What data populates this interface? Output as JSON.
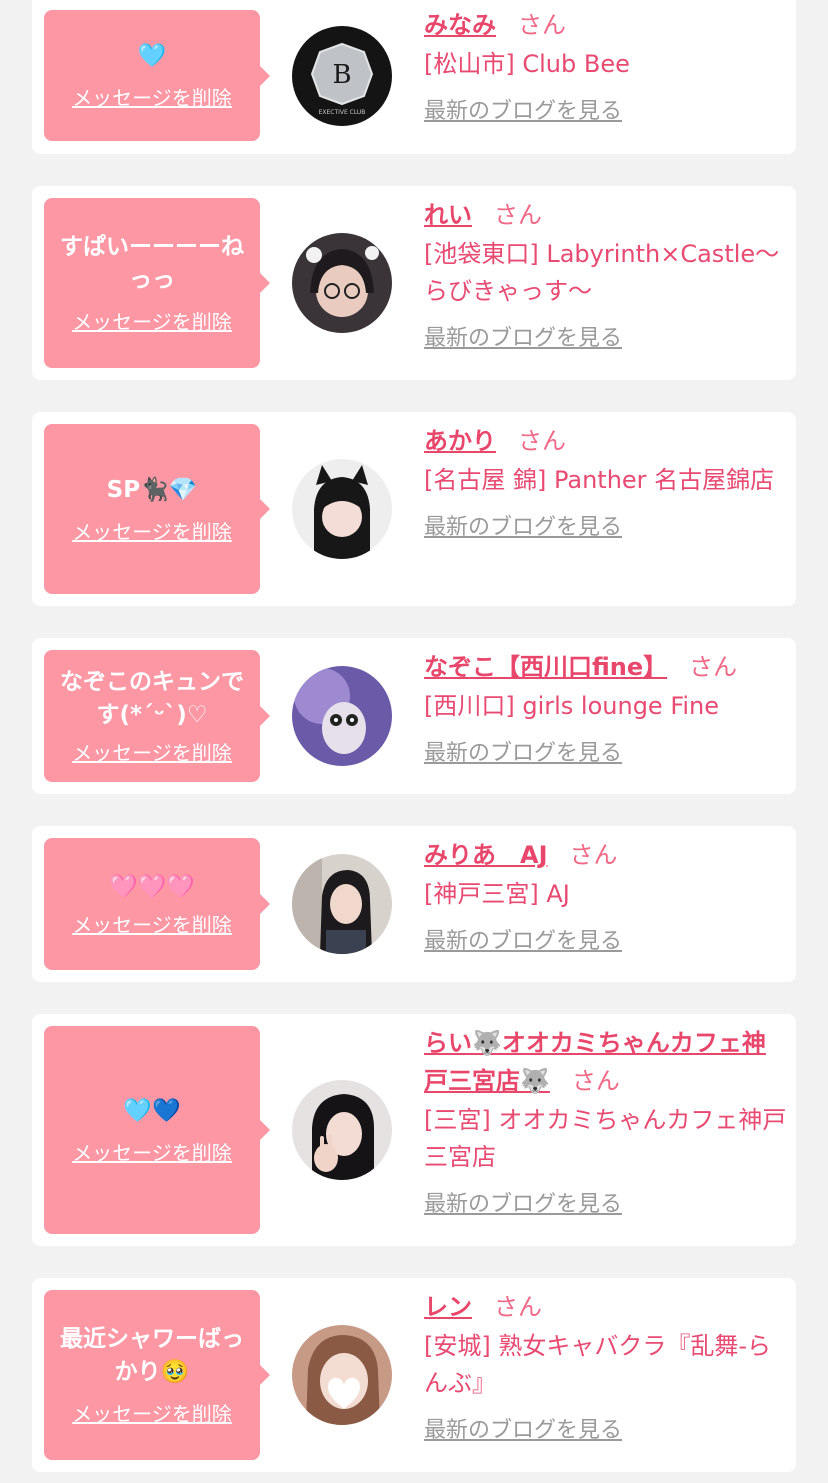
{
  "common": {
    "delete_label": "メッセージを削除",
    "san": "さん",
    "blog_label": "最新のブログを見る"
  },
  "colors": {
    "page_bg": "#f2f2f2",
    "card_bg": "#ffffff",
    "bubble_bg": "#fe97a4",
    "accent": "#e8476b",
    "link_gray": "#9a9a9a"
  },
  "entries": [
    {
      "message": "🩵",
      "name": "みなみ",
      "shop": "[松山市] Club Bee"
    },
    {
      "message": "すぱいーーーーねっっ",
      "name": "れい",
      "shop": "[池袋東口] Labyrinth×Castle〜らびきゃっす〜"
    },
    {
      "message": "SP🐈‍⬛💎",
      "name": "あかり",
      "shop": "[名古屋 錦] Panther 名古屋錦店"
    },
    {
      "message": "なぞこのキュンです(*ˊᵕˋ)♡",
      "name": "なぞこ【西川口fine】",
      "shop": "[西川口] girls lounge Fine"
    },
    {
      "message": "🩷🩷🩷",
      "name": "みりあ　AJ",
      "shop": "[神戸三宮] AJ"
    },
    {
      "message": "🩵💙",
      "name": "らい🐺オオカミちゃんカフェ神戸三宮店🐺",
      "shop": "[三宮] オオカミちゃんカフェ神戸三宮店"
    },
    {
      "message": "最近シャワーばっかり🥹",
      "name": "レン",
      "shop": "[安城] 熟女キャバクラ『乱舞-らんぶ』"
    }
  ]
}
